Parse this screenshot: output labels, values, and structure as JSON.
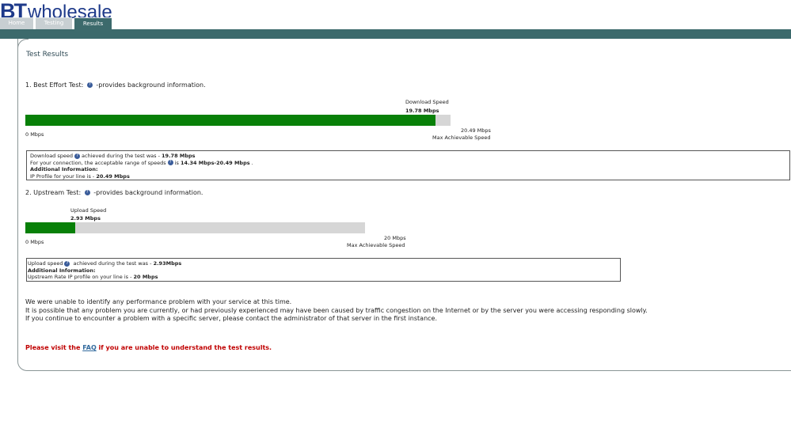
{
  "header": {
    "logo_bt": "BT",
    "logo_wholesale": "wholesale",
    "tabs": [
      {
        "label": "Home"
      },
      {
        "label": "Testing"
      },
      {
        "label": "Results"
      }
    ]
  },
  "page": {
    "title": "Test Results"
  },
  "best_effort": {
    "heading_prefix": "1. Best Effort Test:",
    "heading_suffix": "-provides background information.",
    "speed_label": "Download Speed",
    "speed_value": "19.78 Mbps",
    "min_label": "0 Mbps",
    "max_value": "20.49 Mbps",
    "max_label": "Max Achievable Speed",
    "fill_fraction": 0.9653,
    "details": {
      "line1_prefix": "Download speed",
      "line1_middle": "achieved during the test was - ",
      "line1_value": "19.78 Mbps",
      "line2_prefix": "For your connection, the acceptable range of speeds",
      "line2_middle": "is ",
      "line2_value": "14.34 Mbps-20.49 Mbps",
      "line2_suffix": " .",
      "additional": "Additional Information:",
      "line4_prefix": "IP Profile for your line is - ",
      "line4_value": "20.49 Mbps"
    }
  },
  "upstream": {
    "heading_prefix": "2. Upstream Test:",
    "heading_suffix": "-provides background information.",
    "speed_label": "Upload Speed",
    "speed_value": "2.93 Mbps",
    "min_label": "0 Mbps",
    "max_value": "20 Mbps",
    "max_label": "Max Achievable Speed",
    "fill_fraction": 0.1465,
    "details": {
      "line1_prefix": "Upload speed",
      "line1_middle": " achieved during the test was - ",
      "line1_value": "2.93Mbps",
      "additional": "Additional Information:",
      "line3_prefix": "Upstream Rate IP profile on your line is - ",
      "line3_value": "20 Mbps"
    }
  },
  "messages": {
    "line1": "We were unable to identify any performance problem with your service at this time.",
    "line2": "It is possible that any problem you are currently, or had previously experienced may have been caused by traffic congestion on the Internet or by the server you were accessing responding slowly.",
    "line3": "If you continue to encounter a problem with a specific server, please contact the administrator of that server in the first instance."
  },
  "faq": {
    "prefix": "Please visit the ",
    "link": "FAQ",
    "suffix": " if you are unable to understand the test results."
  },
  "colors": {
    "header_bar": "#3c6a6c",
    "progress_fill": "#088008",
    "progress_track": "#d6d6d6",
    "faq_text": "#c00000"
  }
}
